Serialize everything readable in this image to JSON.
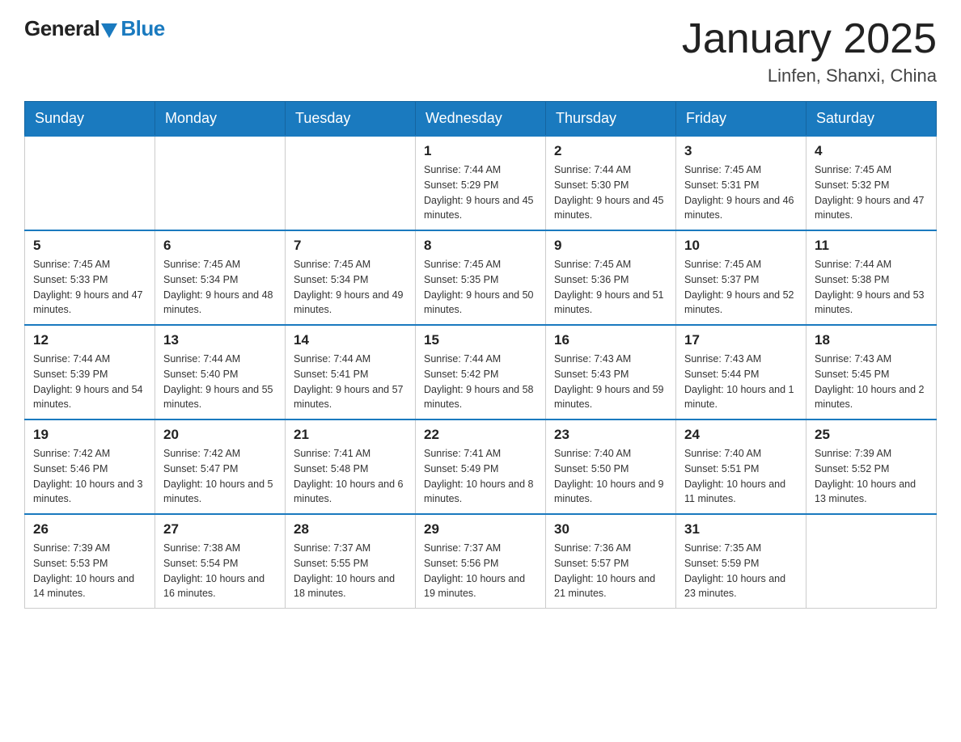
{
  "header": {
    "logo_text_general": "General",
    "logo_text_blue": "Blue",
    "title": "January 2025",
    "subtitle": "Linfen, Shanxi, China"
  },
  "weekdays": [
    "Sunday",
    "Monday",
    "Tuesday",
    "Wednesday",
    "Thursday",
    "Friday",
    "Saturday"
  ],
  "weeks": [
    [
      {
        "day": "",
        "info": ""
      },
      {
        "day": "",
        "info": ""
      },
      {
        "day": "",
        "info": ""
      },
      {
        "day": "1",
        "info": "Sunrise: 7:44 AM\nSunset: 5:29 PM\nDaylight: 9 hours\nand 45 minutes."
      },
      {
        "day": "2",
        "info": "Sunrise: 7:44 AM\nSunset: 5:30 PM\nDaylight: 9 hours\nand 45 minutes."
      },
      {
        "day": "3",
        "info": "Sunrise: 7:45 AM\nSunset: 5:31 PM\nDaylight: 9 hours\nand 46 minutes."
      },
      {
        "day": "4",
        "info": "Sunrise: 7:45 AM\nSunset: 5:32 PM\nDaylight: 9 hours\nand 47 minutes."
      }
    ],
    [
      {
        "day": "5",
        "info": "Sunrise: 7:45 AM\nSunset: 5:33 PM\nDaylight: 9 hours\nand 47 minutes."
      },
      {
        "day": "6",
        "info": "Sunrise: 7:45 AM\nSunset: 5:34 PM\nDaylight: 9 hours\nand 48 minutes."
      },
      {
        "day": "7",
        "info": "Sunrise: 7:45 AM\nSunset: 5:34 PM\nDaylight: 9 hours\nand 49 minutes."
      },
      {
        "day": "8",
        "info": "Sunrise: 7:45 AM\nSunset: 5:35 PM\nDaylight: 9 hours\nand 50 minutes."
      },
      {
        "day": "9",
        "info": "Sunrise: 7:45 AM\nSunset: 5:36 PM\nDaylight: 9 hours\nand 51 minutes."
      },
      {
        "day": "10",
        "info": "Sunrise: 7:45 AM\nSunset: 5:37 PM\nDaylight: 9 hours\nand 52 minutes."
      },
      {
        "day": "11",
        "info": "Sunrise: 7:44 AM\nSunset: 5:38 PM\nDaylight: 9 hours\nand 53 minutes."
      }
    ],
    [
      {
        "day": "12",
        "info": "Sunrise: 7:44 AM\nSunset: 5:39 PM\nDaylight: 9 hours\nand 54 minutes."
      },
      {
        "day": "13",
        "info": "Sunrise: 7:44 AM\nSunset: 5:40 PM\nDaylight: 9 hours\nand 55 minutes."
      },
      {
        "day": "14",
        "info": "Sunrise: 7:44 AM\nSunset: 5:41 PM\nDaylight: 9 hours\nand 57 minutes."
      },
      {
        "day": "15",
        "info": "Sunrise: 7:44 AM\nSunset: 5:42 PM\nDaylight: 9 hours\nand 58 minutes."
      },
      {
        "day": "16",
        "info": "Sunrise: 7:43 AM\nSunset: 5:43 PM\nDaylight: 9 hours\nand 59 minutes."
      },
      {
        "day": "17",
        "info": "Sunrise: 7:43 AM\nSunset: 5:44 PM\nDaylight: 10 hours\nand 1 minute."
      },
      {
        "day": "18",
        "info": "Sunrise: 7:43 AM\nSunset: 5:45 PM\nDaylight: 10 hours\nand 2 minutes."
      }
    ],
    [
      {
        "day": "19",
        "info": "Sunrise: 7:42 AM\nSunset: 5:46 PM\nDaylight: 10 hours\nand 3 minutes."
      },
      {
        "day": "20",
        "info": "Sunrise: 7:42 AM\nSunset: 5:47 PM\nDaylight: 10 hours\nand 5 minutes."
      },
      {
        "day": "21",
        "info": "Sunrise: 7:41 AM\nSunset: 5:48 PM\nDaylight: 10 hours\nand 6 minutes."
      },
      {
        "day": "22",
        "info": "Sunrise: 7:41 AM\nSunset: 5:49 PM\nDaylight: 10 hours\nand 8 minutes."
      },
      {
        "day": "23",
        "info": "Sunrise: 7:40 AM\nSunset: 5:50 PM\nDaylight: 10 hours\nand 9 minutes."
      },
      {
        "day": "24",
        "info": "Sunrise: 7:40 AM\nSunset: 5:51 PM\nDaylight: 10 hours\nand 11 minutes."
      },
      {
        "day": "25",
        "info": "Sunrise: 7:39 AM\nSunset: 5:52 PM\nDaylight: 10 hours\nand 13 minutes."
      }
    ],
    [
      {
        "day": "26",
        "info": "Sunrise: 7:39 AM\nSunset: 5:53 PM\nDaylight: 10 hours\nand 14 minutes."
      },
      {
        "day": "27",
        "info": "Sunrise: 7:38 AM\nSunset: 5:54 PM\nDaylight: 10 hours\nand 16 minutes."
      },
      {
        "day": "28",
        "info": "Sunrise: 7:37 AM\nSunset: 5:55 PM\nDaylight: 10 hours\nand 18 minutes."
      },
      {
        "day": "29",
        "info": "Sunrise: 7:37 AM\nSunset: 5:56 PM\nDaylight: 10 hours\nand 19 minutes."
      },
      {
        "day": "30",
        "info": "Sunrise: 7:36 AM\nSunset: 5:57 PM\nDaylight: 10 hours\nand 21 minutes."
      },
      {
        "day": "31",
        "info": "Sunrise: 7:35 AM\nSunset: 5:59 PM\nDaylight: 10 hours\nand 23 minutes."
      },
      {
        "day": "",
        "info": ""
      }
    ]
  ]
}
